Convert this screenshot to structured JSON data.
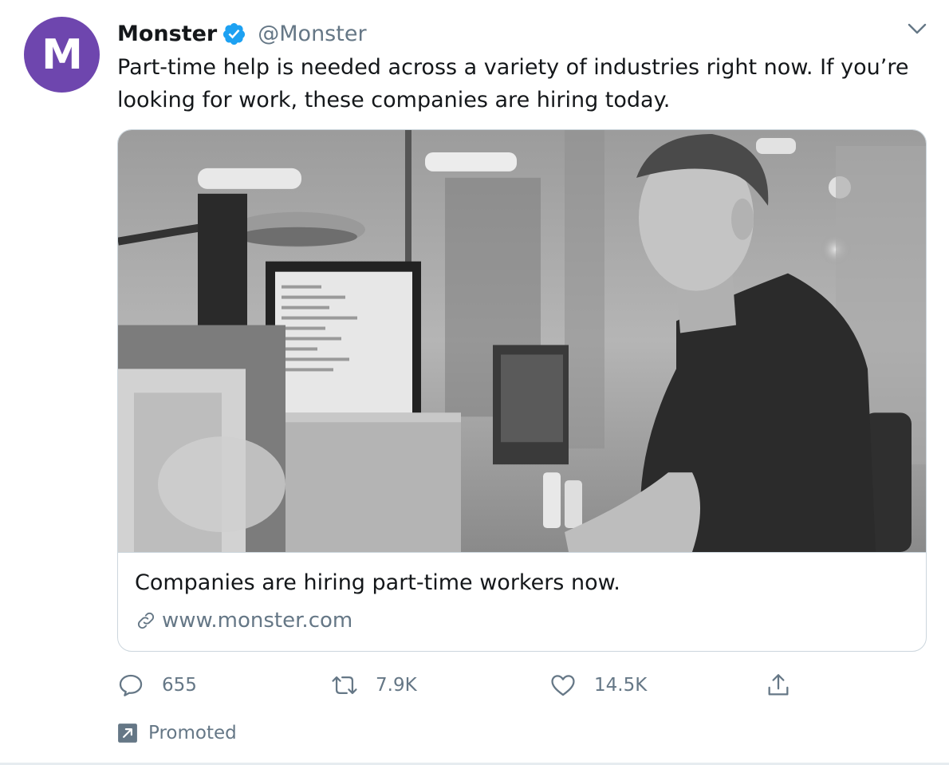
{
  "tweet": {
    "author": {
      "name": "Monster",
      "handle": "@Monster",
      "avatar_letter": "M",
      "avatar_color": "#6e46ae",
      "verified": true,
      "verified_icon": "verified-badge-icon"
    },
    "text": "Part-time help is needed across a variety of industries right now. If you’re looking for work, these companies are hiring today.",
    "more_icon": "chevron-down-icon",
    "card": {
      "image": "grayscale-photo-man-at-computer-warehouse",
      "title": "Companies are hiring part-time workers now.",
      "link_icon": "link-icon",
      "url": "www.monster.com"
    },
    "actions": {
      "reply": {
        "icon": "reply-icon",
        "count": "655"
      },
      "retweet": {
        "icon": "retweet-icon",
        "count": "7.9K"
      },
      "like": {
        "icon": "heart-icon",
        "count": "14.5K"
      },
      "share": {
        "icon": "share-icon"
      }
    },
    "promoted": {
      "icon": "promoted-arrow-icon",
      "label": "Promoted"
    }
  },
  "colors": {
    "text_primary": "#14171a",
    "text_secondary": "#657786",
    "verified_blue": "#1da1f2",
    "border": "#ccd6dd"
  }
}
